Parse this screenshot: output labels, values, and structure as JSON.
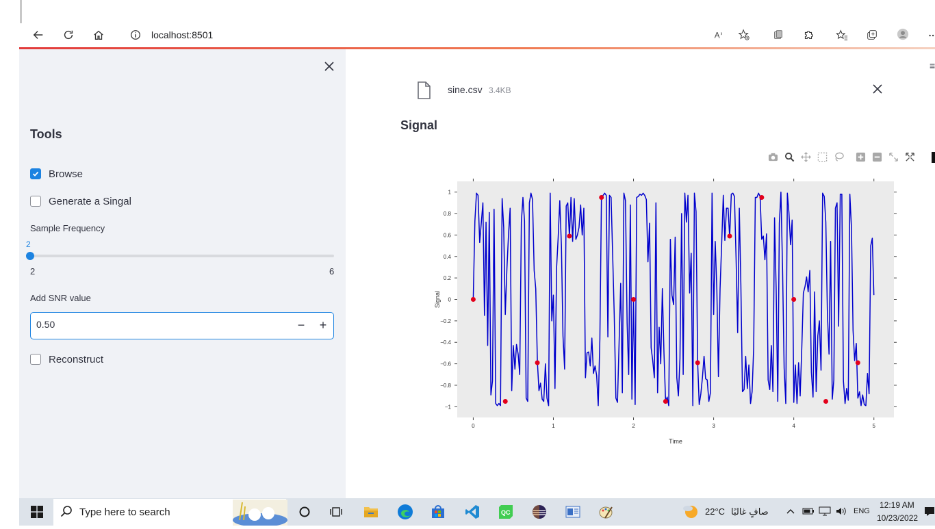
{
  "browser": {
    "url": "localhost:8501",
    "icons": [
      "back-icon",
      "refresh-icon",
      "home-icon",
      "info-icon",
      "read-aloud-icon",
      "add-favorite-icon",
      "extension-icon",
      "puzzle-icon",
      "favorites-icon",
      "collections-icon",
      "profile-icon",
      "more-icon"
    ],
    "read_aloud_glyph": "A"
  },
  "sidebar": {
    "title": "Tools",
    "browse_label": "Browse",
    "browse_checked": true,
    "generate_label": "Generate a Singal",
    "generate_checked": false,
    "sample_frequency_label": "Sample Frequency",
    "sample_frequency_value": "2",
    "sample_frequency_min": "2",
    "sample_frequency_max": "6",
    "snr_label": "Add SNR value",
    "snr_value": "0.50",
    "snr_minus": "−",
    "snr_plus": "+",
    "reconstruct_label": "Reconstruct",
    "reconstruct_checked": false
  },
  "main": {
    "file_name": "sine.csv",
    "file_size": "3.4KB",
    "section_title": "Signal",
    "hamburger": "≡"
  },
  "chart_data": {
    "type": "line",
    "title": "",
    "xlabel": "Time",
    "ylabel": "Signal",
    "xlim": [
      -0.2,
      5.25
    ],
    "ylim": [
      -1.1,
      1.1
    ],
    "xticks": [
      "0",
      "1",
      "2",
      "3",
      "4",
      "5"
    ],
    "yticks": [
      "1",
      "0.8",
      "0.6",
      "0.4",
      "0.2",
      "0",
      "−0.2",
      "−0.4",
      "−0.6",
      "−0.8",
      "−1"
    ],
    "line_color": "#0000cc",
    "sample_color": "#e3001b",
    "background": "#ebebeb",
    "grid": false,
    "series": [
      {
        "values_x": [
          0,
          0.02,
          0.04,
          0.06,
          0.08,
          0.1,
          0.12,
          0.14,
          0.16,
          0.18,
          0.2,
          0.22,
          0.24,
          0.26,
          0.28,
          0.3,
          0.32,
          0.34,
          0.36,
          0.38,
          0.4,
          0.42,
          0.44,
          0.46,
          0.48,
          0.5,
          0.52,
          0.54,
          0.56,
          0.58,
          0.6,
          0.62,
          0.64,
          0.66,
          0.68,
          0.7,
          0.72,
          0.74,
          0.76,
          0.78,
          0.8,
          0.82,
          0.84,
          0.86,
          0.88,
          0.9,
          0.92,
          0.94,
          0.96,
          0.98,
          1.0,
          1.02,
          1.04,
          1.06,
          1.08,
          1.1,
          1.12,
          1.14,
          1.16,
          1.18,
          1.2,
          1.22,
          1.24,
          1.26,
          1.28,
          1.3,
          1.32,
          1.34,
          1.36,
          1.38,
          1.4,
          1.42,
          1.44,
          1.46,
          1.48,
          1.5,
          1.52,
          1.54,
          1.56,
          1.58,
          1.6,
          1.62,
          1.64,
          1.66,
          1.68,
          1.7,
          1.72,
          1.74,
          1.76,
          1.78,
          1.8,
          1.82,
          1.84,
          1.86,
          1.88,
          1.9,
          1.92,
          1.94,
          1.96,
          1.98,
          2.0,
          2.02,
          2.04,
          2.06,
          2.08,
          2.1,
          2.12,
          2.14,
          2.16,
          2.18,
          2.2,
          2.22,
          2.24,
          2.26,
          2.28,
          2.3,
          2.32,
          2.34,
          2.36,
          2.38,
          2.4,
          2.42,
          2.44,
          2.46,
          2.48,
          2.5,
          2.52,
          2.54,
          2.56,
          2.58,
          2.6,
          2.62,
          2.64,
          2.66,
          2.68,
          2.7,
          2.72,
          2.74,
          2.76,
          2.78,
          2.8,
          2.82,
          2.84,
          2.86,
          2.88,
          2.9,
          2.92,
          2.94,
          2.96,
          2.98,
          3.0,
          3.02,
          3.04,
          3.06,
          3.08,
          3.1,
          3.12,
          3.14,
          3.16,
          3.18,
          3.2,
          3.22,
          3.24,
          3.26,
          3.28,
          3.3,
          3.32,
          3.34,
          3.36,
          3.38,
          3.4,
          3.42,
          3.44,
          3.46,
          3.48,
          3.5,
          3.52,
          3.54,
          3.56,
          3.58,
          3.6,
          3.62,
          3.64,
          3.66,
          3.68,
          3.7,
          3.72,
          3.74,
          3.76,
          3.78,
          3.8,
          3.82,
          3.84,
          3.86,
          3.88,
          3.9,
          3.92,
          3.94,
          3.96,
          3.98,
          4.0,
          4.02,
          4.04,
          4.06,
          4.08,
          4.1,
          4.12,
          4.14,
          4.16,
          4.18,
          4.2,
          4.22,
          4.24,
          4.26,
          4.28,
          4.3,
          4.32,
          4.34,
          4.36,
          4.38,
          4.4,
          4.42,
          4.44,
          4.46,
          4.48,
          4.5,
          4.52,
          4.54,
          4.56,
          4.58,
          4.6,
          4.62,
          4.64,
          4.66,
          4.68,
          4.7,
          4.72,
          4.74,
          4.76,
          4.78,
          4.8,
          4.82,
          4.84,
          4.86,
          4.88,
          4.9,
          4.92,
          4.94,
          4.96,
          4.98,
          5.0
        ],
        "values_y": [
          0,
          0.73,
          0.99,
          0.97,
          0.53,
          0.71,
          0.9,
          -0.15,
          0.72,
          -0.43,
          0.81,
          -0.89,
          -0.76,
          0.84,
          -0.97,
          -0.99,
          -0.97,
          -0.99,
          0.94,
          0.67,
          -0.14,
          0.29,
          0.6,
          0.85,
          -0.85,
          -0.43,
          -0.65,
          -0.42,
          -0.51,
          -0.7,
          0.72,
          0.95,
          0.73,
          -0.92,
          -0.95,
          0.9,
          0.99,
          0.93,
          0.27,
          0.1,
          -0.58,
          -0.85,
          -0.78,
          -0.93,
          -0.95,
          -0.6,
          -0.92,
          -0.99,
          0.99,
          -0.2,
          0.04,
          -0.83,
          0.3,
          0.58,
          0.92,
          0.5,
          -0.34,
          -0.65,
          0.87,
          0.9,
          0.58,
          0.95,
          0.54,
          0.94,
          0.56,
          0.6,
          0.67,
          0.88,
          0.6,
          0.85,
          -0.73,
          -0.5,
          -0.49,
          -0.62,
          -0.36,
          -0.69,
          -0.62,
          -0.71,
          -0.99,
          -0.37,
          0.95,
          0.97,
          0.99,
          0.97,
          -0.35,
          0.97,
          0.95,
          0.41,
          -0.15,
          -0.92,
          -0.96,
          -0.4,
          0.15,
          -0.87,
          0.99,
          0.92,
          -0.22,
          -0.7,
          0.88,
          -0.93,
          0.0,
          -0.98,
          0.95,
          0.96,
          0.98,
          0.97,
          0.99,
          0.97,
          0.93,
          0.35,
          0.71,
          -0.45,
          -0.57,
          -0.73,
          0.9,
          -0.87,
          -0.26,
          -0.6,
          0.1,
          -0.49,
          -0.95,
          -0.91,
          -0.99,
          0.56,
          0.04,
          -0.05,
          0.58,
          -0.73,
          -0.9,
          -0.55,
          0.8,
          -0.7,
          0.99,
          0.72,
          0.97,
          0.06,
          0.43,
          -0.99,
          0.99,
          0.82,
          -0.58,
          -0.98,
          -0.88,
          -0.73,
          -0.53,
          -0.74,
          -0.75,
          -0.95,
          -0.87,
          0.99,
          -0.14,
          0.54,
          0.09,
          -0.72,
          0.1,
          0.51,
          0.97,
          0.55,
          0.85,
          0.85,
          0.58,
          0.98,
          0.99,
          0.96,
          0.38,
          -0.31,
          0.85,
          0.13,
          -0.86,
          -0.84,
          -0.53,
          -0.83,
          -0.61,
          -0.97,
          -0.86,
          -0.45,
          0.95,
          0.95,
          0.99,
          0.96,
          0.56,
          0.59,
          0.37,
          0.61,
          -0.75,
          -0.84,
          -0.43,
          -0.86,
          0.76,
          0.11,
          -0.95,
          0.71,
          1.0,
          0.28,
          -0.64,
          -0.97,
          0.99,
          0.81,
          0.51,
          0.74,
          -0.96,
          -0.61,
          -0.97,
          -0.59,
          -0.9,
          -0.45,
          0.06,
          0.12,
          0.21,
          0.07,
          0.27,
          -0.68,
          -0.91,
          0.07,
          -0.86,
          -0.34,
          -0.2,
          -0.66,
          0.99,
          0.96,
          0.72,
          -0.13,
          -0.51,
          0.54,
          -0.93,
          -0.75,
          0.85,
          0.9,
          -0.25,
          0.98,
          0.98,
          -0.76,
          -0.97,
          -0.83,
          -0.94,
          0.98,
          0.66,
          -0.29,
          -0.57,
          -0.41,
          -0.92,
          -0.86,
          -0.99,
          -0.89,
          -0.98,
          -0.99,
          -0.69,
          -0.88,
          0.5,
          0.57,
          0.04,
          -0.06
        ]
      }
    ],
    "samples": {
      "x": [
        0,
        0.4,
        0.8,
        1.2,
        1.6,
        2.0,
        2.4,
        2.8,
        3.2,
        3.6,
        4.0,
        4.4,
        4.8
      ],
      "y": [
        0,
        -0.95,
        -0.59,
        0.59,
        0.95,
        0,
        -0.95,
        -0.59,
        0.59,
        0.95,
        0,
        -0.95,
        -0.59
      ]
    }
  },
  "taskbar": {
    "search_placeholder": "Type here to search",
    "temperature": "22°C",
    "weather_desc": "صافٍ غالبًا",
    "language": "ENG",
    "time": "12:19 AM",
    "date": "10/23/2022"
  }
}
